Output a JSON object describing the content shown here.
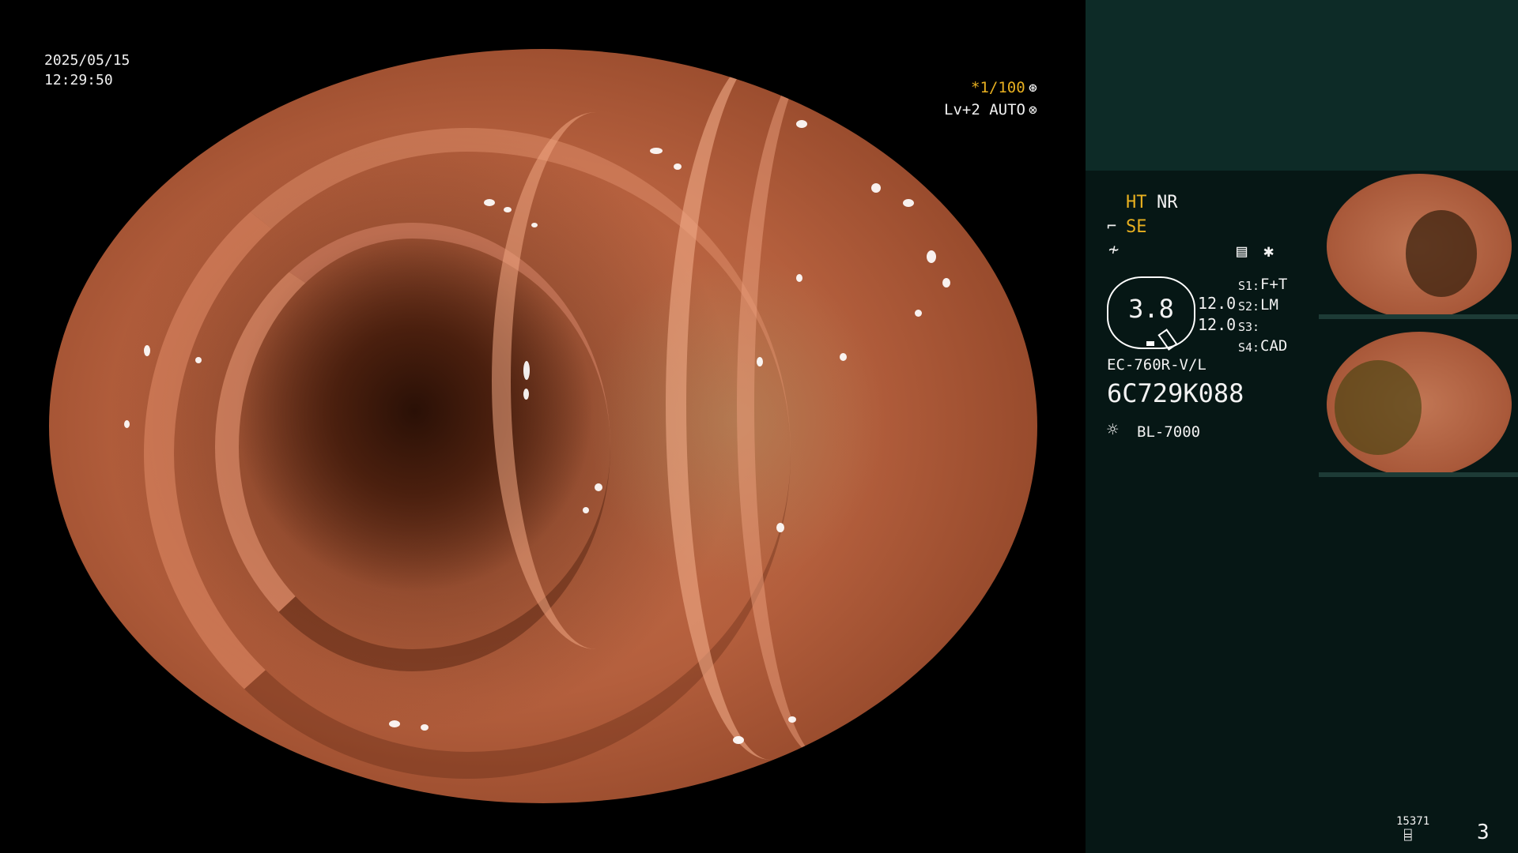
{
  "overlay": {
    "date": "2025/05/15",
    "time": "12:29:50",
    "shutter": "*1/100",
    "level": "Lv+2 AUTO"
  },
  "panel": {
    "ht": "HT",
    "nr": "NR",
    "se": "SE",
    "scope_value": "3.8",
    "val_top": "12.0",
    "val_bottom": "12.0",
    "switches": [
      {
        "key": "S1:",
        "value": "F+T"
      },
      {
        "key": "S2:",
        "value": "LM"
      },
      {
        "key": "S3:",
        "value": ""
      },
      {
        "key": "S4:",
        "value": "CAD"
      }
    ],
    "scope_model": "EC-760R-V/L",
    "serial": "6C729K088",
    "light_source": "BL-7000",
    "counter_small": "15371",
    "counter_big": "3"
  },
  "colors": {
    "accent_yellow": "#e8b020",
    "panel_bg": "#061715",
    "panel_top_bg": "#0d2b27"
  },
  "icons": {
    "shutter": "aperture-icon",
    "level": "auto-iris-icon",
    "ht": "tilde-icon",
    "se": "edge-icon",
    "memo": "document-icon",
    "star": "asterisk-icon",
    "light": "sun-icon",
    "record": "cylinder-icon"
  }
}
